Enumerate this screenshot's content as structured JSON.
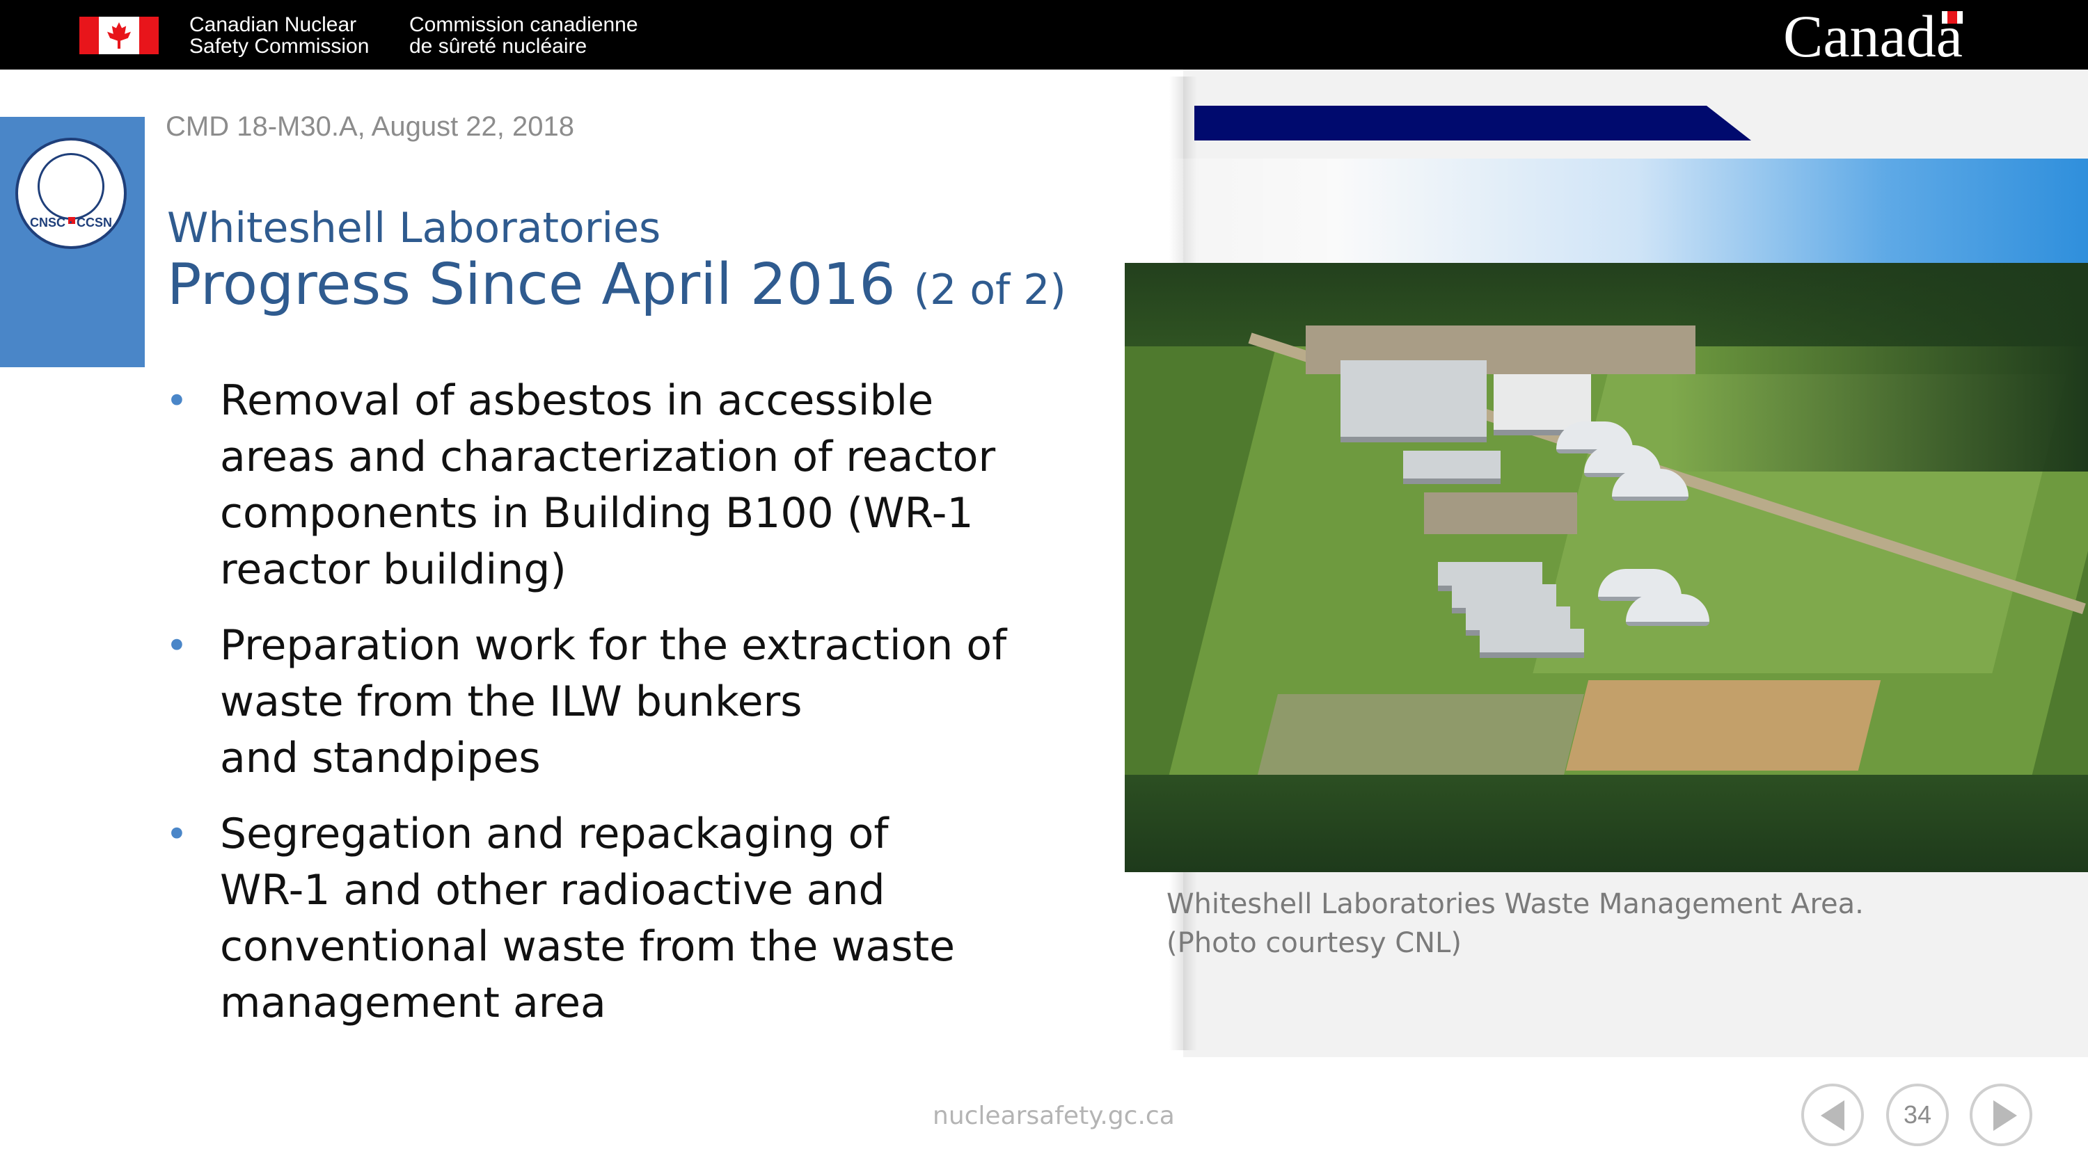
{
  "header": {
    "org_name_en_line1": "Canadian Nuclear",
    "org_name_en_line2": "Safety Commission",
    "org_name_fr_line1": "Commission canadienne",
    "org_name_fr_line2": "de sûreté nucléaire",
    "wordmark": "Canada"
  },
  "logo": {
    "text": "CNSC · CCSN"
  },
  "slide": {
    "meta": "CMD 18-M30.A, August 22, 2018",
    "title_line1": "Whiteshell Laboratories",
    "title_line2": "Progress Since April 2016",
    "title_part": "(2 of 2)",
    "bullets": [
      "Removal of asbestos in accessible\nareas and characterization of reactor\ncomponents in Building B100 (WR-1\nreactor building)",
      "Preparation work for the extraction of\nwaste from the ILW bunkers\nand standpipes",
      "Segregation and repackaging of\nWR-1 and other radioactive and\nconventional waste from the waste\nmanagement area"
    ],
    "caption_line1": "Whiteshell Laboratories Waste Management Area.",
    "caption_line2": "(Photo courtesy CNL)"
  },
  "footer": {
    "url": "nuclearsafety.gc.ca",
    "page_number": "34"
  },
  "icons": {
    "flag": "canada-flag-icon",
    "prev": "arrow-left-icon",
    "next": "arrow-right-icon"
  },
  "colors": {
    "title_blue": "#2f5b8f",
    "accent_blue": "#4a86c8",
    "navy": "#000a6e",
    "flag_red": "#e8151b"
  }
}
